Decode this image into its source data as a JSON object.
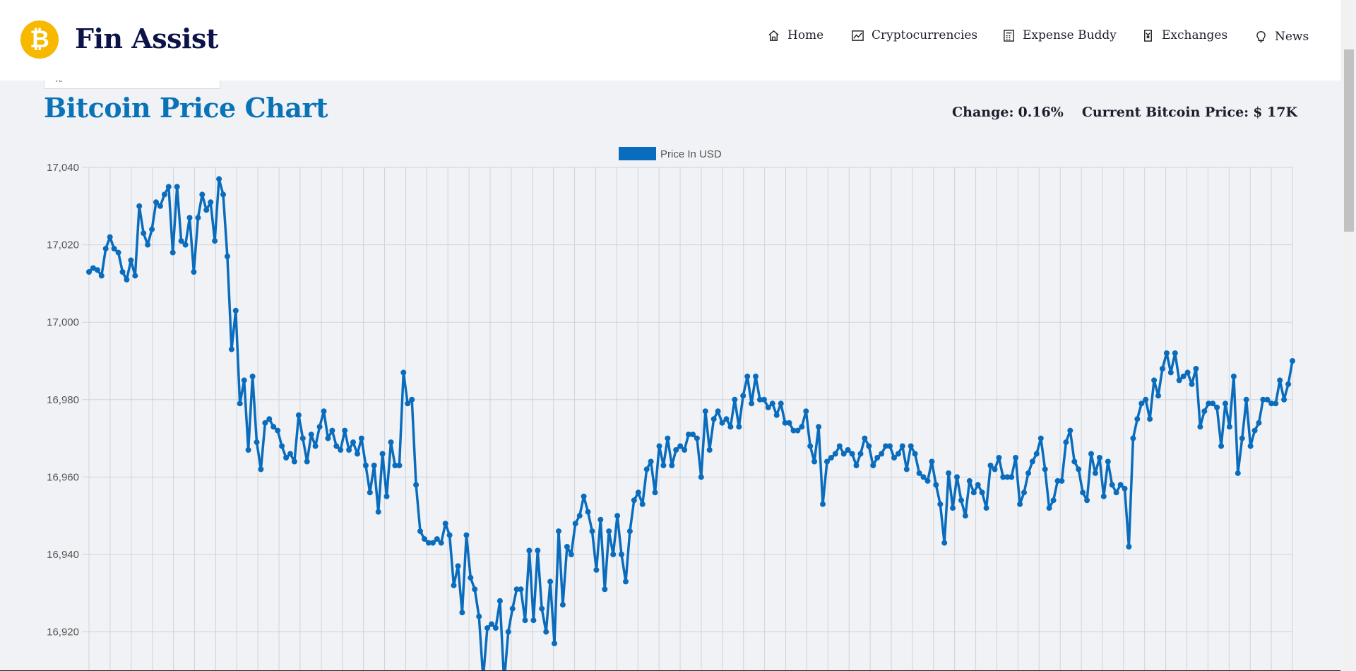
{
  "brand": {
    "name": "Fin Assist",
    "logo_glyph": "₿",
    "logo_color": "#f7b800"
  },
  "nav": [
    {
      "label": "Home",
      "icon": "home-icon"
    },
    {
      "label": "Cryptocurrencies",
      "icon": "chart-line-icon"
    },
    {
      "label": "Expense Buddy",
      "icon": "calculator-icon"
    },
    {
      "label": "Exchanges",
      "icon": "exchange-icon"
    },
    {
      "label": "News",
      "icon": "bulb-icon"
    }
  ],
  "search": {
    "partial_text": "Al"
  },
  "page": {
    "title": "Bitcoin Price Chart",
    "change_label": "Change:",
    "change_value": "0.16%",
    "price_label": "Current Bitcoin Price:",
    "price_value": "$ 17K"
  },
  "colors": {
    "accent": "#0a73b8",
    "line": "#0a6cbd",
    "brand_dark": "#0b1349"
  },
  "chart_data": {
    "type": "line",
    "legend": "Price In USD",
    "legend_position": "top-center",
    "grid": true,
    "yticks": [
      "17,040",
      "17,020",
      "17,000",
      "16,980",
      "16,960",
      "16,940",
      "16,920"
    ],
    "ylim": [
      16910,
      17040
    ],
    "xlabel": "",
    "ylabel": "",
    "series": [
      {
        "name": "Price In USD",
        "values": [
          17013,
          17014,
          17013.5,
          17012,
          17019,
          17022,
          17019,
          17018,
          17013,
          17011,
          17016,
          17012,
          17030,
          17023,
          17020,
          17024,
          17031,
          17030,
          17033,
          17035,
          17018,
          17035,
          17021,
          17020,
          17027,
          17013,
          17027,
          17033,
          17029,
          17031,
          17021,
          17037,
          17033,
          17017,
          16993,
          17003,
          16979,
          16985,
          16967,
          16986,
          16969,
          16962,
          16974,
          16975,
          16973,
          16972,
          16968,
          16965,
          16966,
          16964,
          16976,
          16970,
          16964,
          16971,
          16968,
          16973,
          16977,
          16970,
          16972,
          16968,
          16967,
          16972,
          16967,
          16969,
          16966,
          16970,
          16963,
          16956,
          16963,
          16951,
          16966,
          16955,
          16969,
          16963,
          16963,
          16987,
          16979,
          16980,
          16958,
          16946,
          16944,
          16943,
          16943,
          16944,
          16943,
          16948,
          16945,
          16932,
          16937,
          16925,
          16945,
          16934,
          16931,
          16924,
          16908,
          16921,
          16922,
          16921,
          16928,
          16907,
          16920,
          16926,
          16931,
          16931,
          16923,
          16941,
          16923,
          16941,
          16926,
          16920,
          16933,
          16917,
          16946,
          16927,
          16942,
          16940,
          16948,
          16950,
          16955,
          16951,
          16946,
          16936,
          16949,
          16931,
          16946,
          16940,
          16950,
          16940,
          16933,
          16946,
          16954,
          16956,
          16953,
          16962,
          16964,
          16956,
          16968,
          16963,
          16970,
          16963,
          16967,
          16968,
          16967,
          16971,
          16971,
          16970,
          16960,
          16977,
          16967,
          16975,
          16977,
          16974,
          16975,
          16973,
          16980,
          16973,
          16981,
          16986,
          16979,
          16986,
          16980,
          16980,
          16978,
          16979,
          16976,
          16979,
          16974,
          16974,
          16972,
          16972,
          16973,
          16977,
          16968,
          16964,
          16973,
          16953,
          16964,
          16965,
          16966,
          16968,
          16966,
          16967,
          16966,
          16963,
          16966,
          16970,
          16968,
          16963,
          16965,
          16966,
          16968,
          16968,
          16965,
          16966,
          16968,
          16962,
          16968,
          16966,
          16961,
          16960,
          16959,
          16964,
          16958,
          16953,
          16943,
          16961,
          16952,
          16960,
          16954,
          16950,
          16959,
          16956,
          16958,
          16956,
          16952,
          16963,
          16962,
          16965,
          16960,
          16960,
          16960,
          16965,
          16953,
          16956,
          16961,
          16964,
          16966,
          16970,
          16962,
          16952,
          16954,
          16959,
          16959,
          16969,
          16972,
          16964,
          16962,
          16956,
          16954,
          16966,
          16961,
          16965,
          16955,
          16964,
          16958,
          16956,
          16958,
          16957,
          16942,
          16970,
          16975,
          16979,
          16980,
          16975,
          16985,
          16981,
          16988,
          16992,
          16987,
          16992,
          16985,
          16986,
          16987,
          16984,
          16988,
          16973,
          16977,
          16979,
          16979,
          16978,
          16968,
          16979,
          16973,
          16986,
          16961,
          16970,
          16980,
          16968,
          16972,
          16974,
          16980,
          16980,
          16979,
          16979,
          16985,
          16980,
          16984,
          16990
        ]
      }
    ]
  }
}
